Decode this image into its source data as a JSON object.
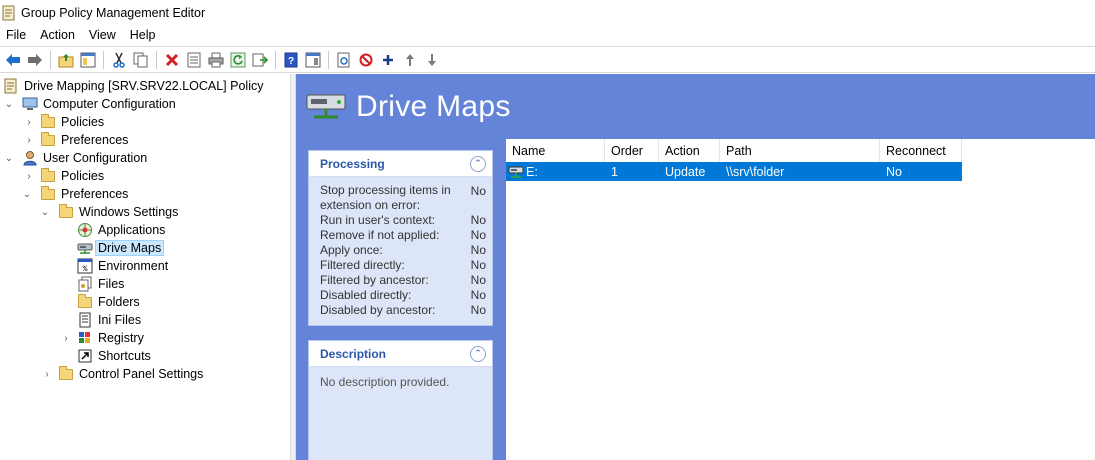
{
  "window": {
    "title": "Group Policy Management Editor"
  },
  "menu": [
    "File",
    "Action",
    "View",
    "Help"
  ],
  "toolbar": {
    "buttons": [
      "back",
      "forward",
      "up-folder",
      "show-hide-tree",
      "cut",
      "copy",
      "delete",
      "properties",
      "print",
      "refresh",
      "export",
      "help",
      "show-hide-action-pane",
      "new-item",
      "stop",
      "add",
      "move-up",
      "move-down"
    ]
  },
  "tree": {
    "root": "Drive Mapping [SRV.SRV22.LOCAL] Policy",
    "computer_configuration": "Computer Configuration",
    "cc_policies": "Policies",
    "cc_preferences": "Preferences",
    "user_configuration": "User Configuration",
    "uc_policies": "Policies",
    "uc_preferences": "Preferences",
    "windows_settings": "Windows Settings",
    "applications": "Applications",
    "drive_maps": "Drive Maps",
    "environment": "Environment",
    "files": "Files",
    "folders": "Folders",
    "ini_files": "Ini Files",
    "registry": "Registry",
    "shortcuts": "Shortcuts",
    "control_panel_settings": "Control Panel Settings"
  },
  "banner": {
    "title": "Drive Maps"
  },
  "processing": {
    "title": "Processing",
    "rows": [
      {
        "k": "Stop processing items in extension on error:",
        "v": "No"
      },
      {
        "k": "Run in user's context:",
        "v": "No"
      },
      {
        "k": "Remove if not applied:",
        "v": "No"
      },
      {
        "k": "Apply once:",
        "v": "No"
      },
      {
        "k": "Filtered directly:",
        "v": "No"
      },
      {
        "k": "Filtered by ancestor:",
        "v": "No"
      },
      {
        "k": "Disabled directly:",
        "v": "No"
      },
      {
        "k": "Disabled by ancestor:",
        "v": "No"
      }
    ]
  },
  "description": {
    "title": "Description",
    "text": "No description provided."
  },
  "grid": {
    "columns": [
      "Name",
      "Order",
      "Action",
      "Path",
      "Reconnect"
    ],
    "rows": [
      {
        "name": "E:",
        "order": "1",
        "action": "Update",
        "path": "\\\\srv\\folder",
        "reconnect": "No"
      }
    ]
  },
  "colors": {
    "banner": "#6384d8",
    "selection": "#0078d7",
    "tree_selection": "#cce8ff"
  }
}
